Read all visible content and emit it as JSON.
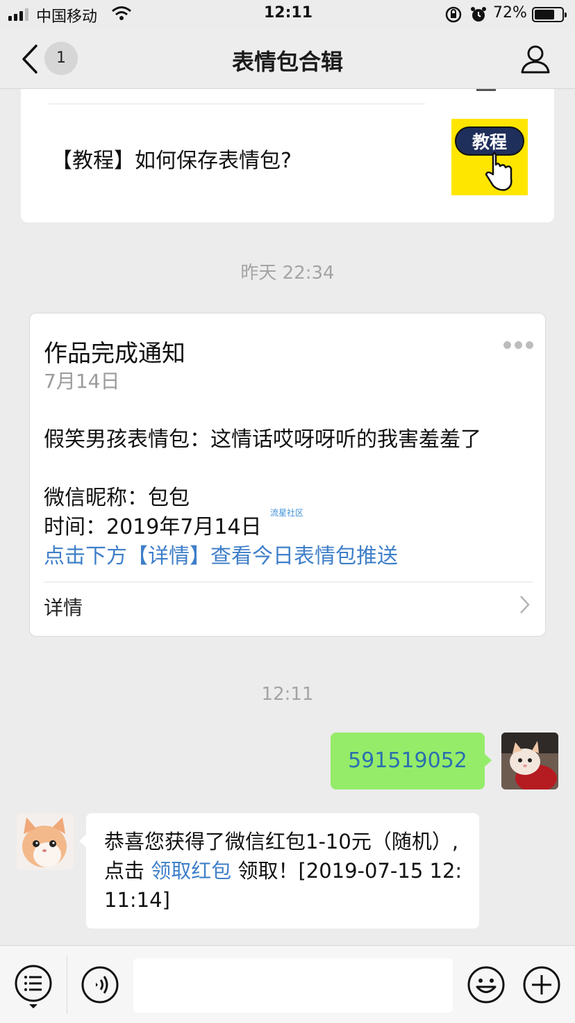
{
  "status_bar": {
    "carrier": "中国移动",
    "time": "12:11",
    "battery": "72%",
    "battery_level": 0.72
  },
  "nav": {
    "unread_count": "1",
    "title": "表情包合辑"
  },
  "article": {
    "title": "【教程】如何保存表情包?",
    "thumb_text": "教程"
  },
  "separators": {
    "first": "昨天 22:34",
    "second": "12:11"
  },
  "notification": {
    "title": "作品完成通知",
    "date": "7月14日",
    "body": "假笑男孩表情包：这情话哎呀呀听的我害羞羞了",
    "nickname": "微信昵称：包包",
    "time": "时间：2019年7月14日",
    "watermark": "流星社区",
    "link": "点击下方【详情】查看今日表情包推送",
    "detail_label": "详情"
  },
  "messages": {
    "sent_text": "591519052",
    "received_prefix": "恭喜您获得了微信红包1-10元（随机）,点击 ",
    "received_link": "领取红包",
    "received_suffix": " 领取！[2019-07-15 12:11:14]"
  },
  "colors": {
    "background": "#ececec",
    "bubble_sent": "#95ec69",
    "link": "#3f7fc9"
  }
}
